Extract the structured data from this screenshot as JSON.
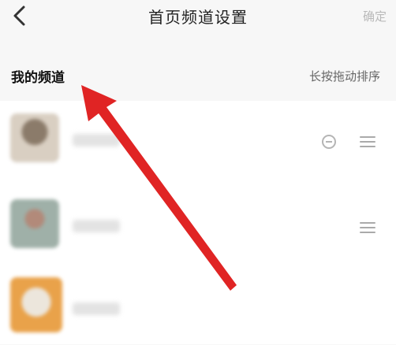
{
  "header": {
    "title": "首页频道设置",
    "confirm_label": "确定",
    "back_icon": "chevron-left-icon"
  },
  "section": {
    "title": "我的频道",
    "hint": "长按拖动排序"
  },
  "channels": [
    {
      "name": "",
      "avatar_color": "#c9b8a5",
      "removable": true,
      "draggable": true
    },
    {
      "name": "",
      "avatar_color": "#8fa39a",
      "removable": false,
      "draggable": true
    },
    {
      "name": "",
      "avatar_color": "#e9a24a",
      "removable": false,
      "draggable": false
    }
  ],
  "colors": {
    "accent_arrow": "#e02424",
    "background": "#f7f7f7",
    "list_background": "#ffffff"
  }
}
